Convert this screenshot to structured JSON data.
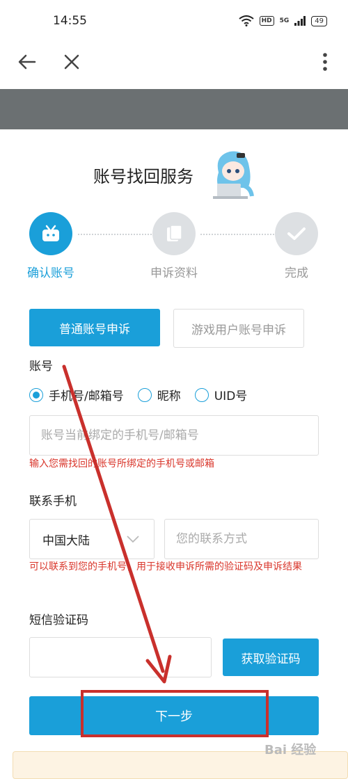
{
  "status_bar": {
    "time": "14:55",
    "hd": "HD",
    "network": "5G",
    "battery": "49"
  },
  "page": {
    "title": "账号找回服务"
  },
  "steps": [
    {
      "label": "确认账号",
      "state": "active",
      "icon": "tv-icon"
    },
    {
      "label": "申诉资料",
      "state": "pending",
      "icon": "document-icon"
    },
    {
      "label": "完成",
      "state": "pending",
      "icon": "check-icon"
    }
  ],
  "tabs": {
    "normal": "普通账号申诉",
    "game": "游戏用户账号申诉"
  },
  "account": {
    "label": "账号",
    "options": [
      "手机号/邮箱号",
      "昵称",
      "UID号"
    ],
    "selected_index": 0,
    "input_placeholder": "账号当前绑定的手机号/邮箱号",
    "hint": "输入您需找回的账号所绑定的手机号或邮箱"
  },
  "contact": {
    "label": "联系手机",
    "region": "中国大陆",
    "input_placeholder": "您的联系方式",
    "hint": "可以联系到您的手机号，用于接收申诉所需的验证码及申诉结果"
  },
  "sms": {
    "label": "短信验证码",
    "input_value": "",
    "get_code_button": "获取验证码"
  },
  "next_button": "下一步",
  "watermark": "Bai 经验",
  "colors": {
    "accent": "#1a9fd9",
    "hint_red": "#d9362b",
    "annotation_red": "#c9302c"
  }
}
